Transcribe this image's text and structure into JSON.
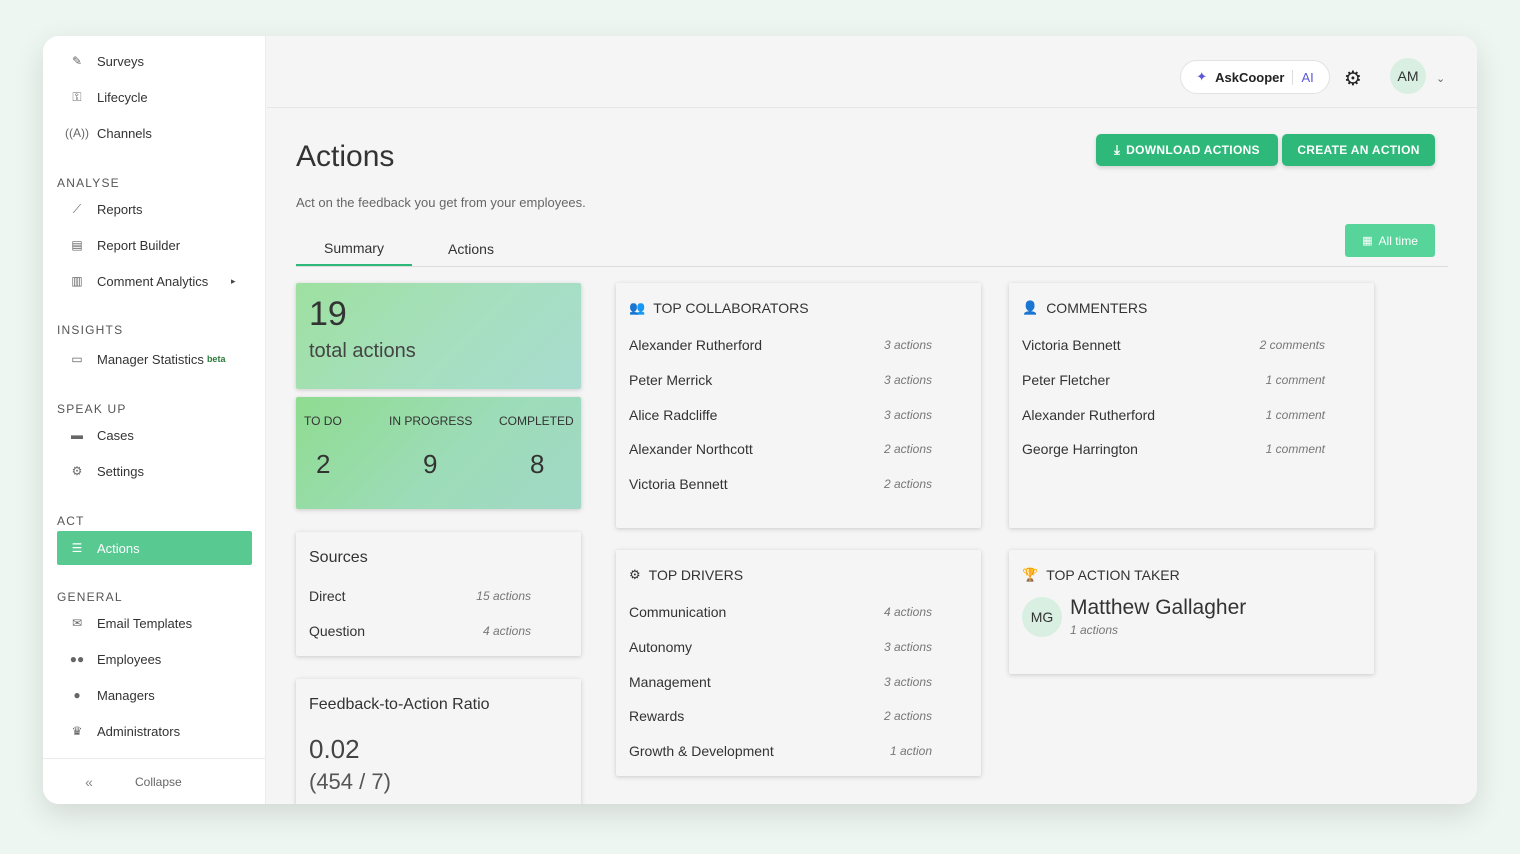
{
  "sidebar": {
    "items_top": [
      {
        "label": "Surveys",
        "icon": "brush-icon"
      },
      {
        "label": "Lifecycle",
        "icon": "key-icon"
      },
      {
        "label": "Channels",
        "icon": "broadcast-icon"
      }
    ],
    "analyse": {
      "heading": "ANALYSE",
      "items": [
        {
          "label": "Reports",
          "icon": "line-chart-icon"
        },
        {
          "label": "Report Builder",
          "icon": "file-edit-icon"
        },
        {
          "label": "Comment Analytics",
          "icon": "bar-chart-icon",
          "caret": "▸"
        }
      ]
    },
    "insights": {
      "heading": "INSIGHTS",
      "items": [
        {
          "label": "Manager Statistics",
          "badge": "beta",
          "icon": "presentation-icon"
        }
      ]
    },
    "speak_up": {
      "heading": "SPEAK UP",
      "items": [
        {
          "label": "Cases",
          "icon": "folder-icon"
        },
        {
          "label": "Settings",
          "icon": "gear-icon"
        }
      ]
    },
    "act": {
      "heading": "ACT",
      "items": [
        {
          "label": "Actions",
          "icon": "list-icon",
          "active": true
        }
      ]
    },
    "general": {
      "heading": "GENERAL",
      "items": [
        {
          "label": "Email Templates",
          "icon": "envelope-icon"
        },
        {
          "label": "Employees",
          "icon": "users-icon"
        },
        {
          "label": "Managers",
          "icon": "user-tie-icon"
        },
        {
          "label": "Administrators",
          "icon": "crown-icon"
        }
      ]
    },
    "collapse_label": "Collapse"
  },
  "topbar": {
    "ask_label": "AskCooper",
    "ai_label": "AI",
    "avatar_initials": "AM"
  },
  "page": {
    "title": "Actions",
    "subtitle": "Act on the feedback you get from your employees.",
    "download_label": "DOWNLOAD ACTIONS",
    "create_label": "CREATE AN ACTION",
    "tabs": [
      "Summary",
      "Actions"
    ],
    "active_tab": "Summary",
    "date_filter": "All time"
  },
  "summary": {
    "total_count": "19",
    "total_label": "total actions",
    "statuses": [
      {
        "label": "TO DO",
        "value": "2"
      },
      {
        "label": "IN PROGRESS",
        "value": "9"
      },
      {
        "label": "COMPLETED",
        "value": "8"
      }
    ]
  },
  "sources": {
    "title": "Sources",
    "rows": [
      {
        "name": "Direct",
        "value": "15 actions"
      },
      {
        "name": "Question",
        "value": "4 actions"
      }
    ]
  },
  "ratio": {
    "title": "Feedback-to-Action Ratio",
    "value": "0.02",
    "detail": "(454 / 7)"
  },
  "top_collaborators": {
    "title": "TOP COLLABORATORS",
    "rows": [
      {
        "name": "Alexander Rutherford",
        "value": "3 actions"
      },
      {
        "name": "Peter Merrick",
        "value": "3 actions"
      },
      {
        "name": "Alice Radcliffe",
        "value": "3 actions"
      },
      {
        "name": "Alexander Northcott",
        "value": "2 actions"
      },
      {
        "name": "Victoria Bennett",
        "value": "2 actions"
      }
    ]
  },
  "commenters": {
    "title": "COMMENTERS",
    "rows": [
      {
        "name": "Victoria Bennett",
        "value": "2 comments"
      },
      {
        "name": "Peter Fletcher",
        "value": "1 comment"
      },
      {
        "name": "Alexander Rutherford",
        "value": "1 comment"
      },
      {
        "name": "George Harrington",
        "value": "1 comment"
      }
    ]
  },
  "top_drivers": {
    "title": "TOP DRIVERS",
    "rows": [
      {
        "name": "Communication",
        "value": "4 actions"
      },
      {
        "name": "Autonomy",
        "value": "3 actions"
      },
      {
        "name": "Management",
        "value": "3 actions"
      },
      {
        "name": "Rewards",
        "value": "2 actions"
      },
      {
        "name": "Growth & Development",
        "value": "1 action"
      }
    ]
  },
  "top_action_taker": {
    "title": "TOP ACTION TAKER",
    "initials": "MG",
    "name": "Matthew Gallagher",
    "count": "1 actions"
  }
}
